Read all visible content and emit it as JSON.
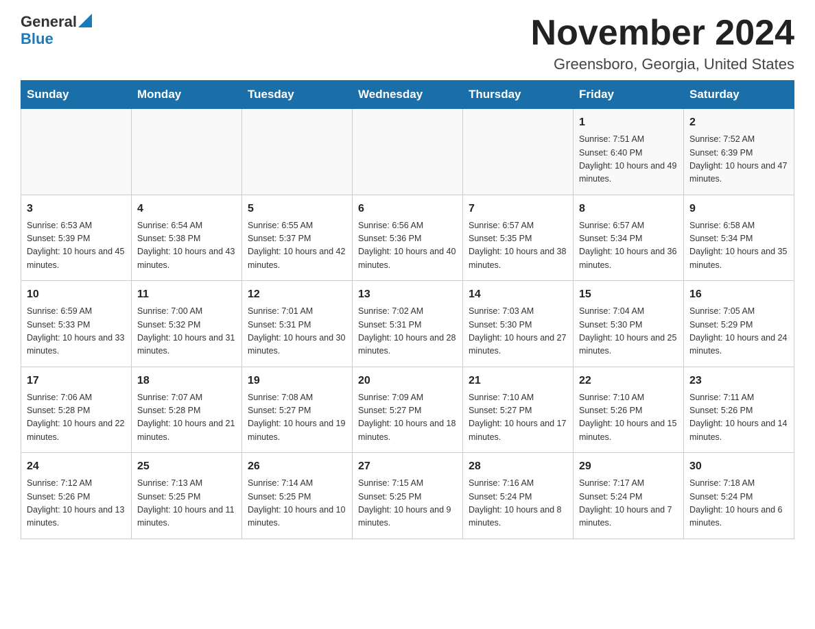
{
  "logo": {
    "general": "General",
    "blue": "Blue"
  },
  "title": "November 2024",
  "subtitle": "Greensboro, Georgia, United States",
  "days_of_week": [
    "Sunday",
    "Monday",
    "Tuesday",
    "Wednesday",
    "Thursday",
    "Friday",
    "Saturday"
  ],
  "weeks": [
    [
      {
        "day": "",
        "sunrise": "",
        "sunset": "",
        "daylight": ""
      },
      {
        "day": "",
        "sunrise": "",
        "sunset": "",
        "daylight": ""
      },
      {
        "day": "",
        "sunrise": "",
        "sunset": "",
        "daylight": ""
      },
      {
        "day": "",
        "sunrise": "",
        "sunset": "",
        "daylight": ""
      },
      {
        "day": "",
        "sunrise": "",
        "sunset": "",
        "daylight": ""
      },
      {
        "day": "1",
        "sunrise": "Sunrise: 7:51 AM",
        "sunset": "Sunset: 6:40 PM",
        "daylight": "Daylight: 10 hours and 49 minutes."
      },
      {
        "day": "2",
        "sunrise": "Sunrise: 7:52 AM",
        "sunset": "Sunset: 6:39 PM",
        "daylight": "Daylight: 10 hours and 47 minutes."
      }
    ],
    [
      {
        "day": "3",
        "sunrise": "Sunrise: 6:53 AM",
        "sunset": "Sunset: 5:39 PM",
        "daylight": "Daylight: 10 hours and 45 minutes."
      },
      {
        "day": "4",
        "sunrise": "Sunrise: 6:54 AM",
        "sunset": "Sunset: 5:38 PM",
        "daylight": "Daylight: 10 hours and 43 minutes."
      },
      {
        "day": "5",
        "sunrise": "Sunrise: 6:55 AM",
        "sunset": "Sunset: 5:37 PM",
        "daylight": "Daylight: 10 hours and 42 minutes."
      },
      {
        "day": "6",
        "sunrise": "Sunrise: 6:56 AM",
        "sunset": "Sunset: 5:36 PM",
        "daylight": "Daylight: 10 hours and 40 minutes."
      },
      {
        "day": "7",
        "sunrise": "Sunrise: 6:57 AM",
        "sunset": "Sunset: 5:35 PM",
        "daylight": "Daylight: 10 hours and 38 minutes."
      },
      {
        "day": "8",
        "sunrise": "Sunrise: 6:57 AM",
        "sunset": "Sunset: 5:34 PM",
        "daylight": "Daylight: 10 hours and 36 minutes."
      },
      {
        "day": "9",
        "sunrise": "Sunrise: 6:58 AM",
        "sunset": "Sunset: 5:34 PM",
        "daylight": "Daylight: 10 hours and 35 minutes."
      }
    ],
    [
      {
        "day": "10",
        "sunrise": "Sunrise: 6:59 AM",
        "sunset": "Sunset: 5:33 PM",
        "daylight": "Daylight: 10 hours and 33 minutes."
      },
      {
        "day": "11",
        "sunrise": "Sunrise: 7:00 AM",
        "sunset": "Sunset: 5:32 PM",
        "daylight": "Daylight: 10 hours and 31 minutes."
      },
      {
        "day": "12",
        "sunrise": "Sunrise: 7:01 AM",
        "sunset": "Sunset: 5:31 PM",
        "daylight": "Daylight: 10 hours and 30 minutes."
      },
      {
        "day": "13",
        "sunrise": "Sunrise: 7:02 AM",
        "sunset": "Sunset: 5:31 PM",
        "daylight": "Daylight: 10 hours and 28 minutes."
      },
      {
        "day": "14",
        "sunrise": "Sunrise: 7:03 AM",
        "sunset": "Sunset: 5:30 PM",
        "daylight": "Daylight: 10 hours and 27 minutes."
      },
      {
        "day": "15",
        "sunrise": "Sunrise: 7:04 AM",
        "sunset": "Sunset: 5:30 PM",
        "daylight": "Daylight: 10 hours and 25 minutes."
      },
      {
        "day": "16",
        "sunrise": "Sunrise: 7:05 AM",
        "sunset": "Sunset: 5:29 PM",
        "daylight": "Daylight: 10 hours and 24 minutes."
      }
    ],
    [
      {
        "day": "17",
        "sunrise": "Sunrise: 7:06 AM",
        "sunset": "Sunset: 5:28 PM",
        "daylight": "Daylight: 10 hours and 22 minutes."
      },
      {
        "day": "18",
        "sunrise": "Sunrise: 7:07 AM",
        "sunset": "Sunset: 5:28 PM",
        "daylight": "Daylight: 10 hours and 21 minutes."
      },
      {
        "day": "19",
        "sunrise": "Sunrise: 7:08 AM",
        "sunset": "Sunset: 5:27 PM",
        "daylight": "Daylight: 10 hours and 19 minutes."
      },
      {
        "day": "20",
        "sunrise": "Sunrise: 7:09 AM",
        "sunset": "Sunset: 5:27 PM",
        "daylight": "Daylight: 10 hours and 18 minutes."
      },
      {
        "day": "21",
        "sunrise": "Sunrise: 7:10 AM",
        "sunset": "Sunset: 5:27 PM",
        "daylight": "Daylight: 10 hours and 17 minutes."
      },
      {
        "day": "22",
        "sunrise": "Sunrise: 7:10 AM",
        "sunset": "Sunset: 5:26 PM",
        "daylight": "Daylight: 10 hours and 15 minutes."
      },
      {
        "day": "23",
        "sunrise": "Sunrise: 7:11 AM",
        "sunset": "Sunset: 5:26 PM",
        "daylight": "Daylight: 10 hours and 14 minutes."
      }
    ],
    [
      {
        "day": "24",
        "sunrise": "Sunrise: 7:12 AM",
        "sunset": "Sunset: 5:26 PM",
        "daylight": "Daylight: 10 hours and 13 minutes."
      },
      {
        "day": "25",
        "sunrise": "Sunrise: 7:13 AM",
        "sunset": "Sunset: 5:25 PM",
        "daylight": "Daylight: 10 hours and 11 minutes."
      },
      {
        "day": "26",
        "sunrise": "Sunrise: 7:14 AM",
        "sunset": "Sunset: 5:25 PM",
        "daylight": "Daylight: 10 hours and 10 minutes."
      },
      {
        "day": "27",
        "sunrise": "Sunrise: 7:15 AM",
        "sunset": "Sunset: 5:25 PM",
        "daylight": "Daylight: 10 hours and 9 minutes."
      },
      {
        "day": "28",
        "sunrise": "Sunrise: 7:16 AM",
        "sunset": "Sunset: 5:24 PM",
        "daylight": "Daylight: 10 hours and 8 minutes."
      },
      {
        "day": "29",
        "sunrise": "Sunrise: 7:17 AM",
        "sunset": "Sunset: 5:24 PM",
        "daylight": "Daylight: 10 hours and 7 minutes."
      },
      {
        "day": "30",
        "sunrise": "Sunrise: 7:18 AM",
        "sunset": "Sunset: 5:24 PM",
        "daylight": "Daylight: 10 hours and 6 minutes."
      }
    ]
  ]
}
